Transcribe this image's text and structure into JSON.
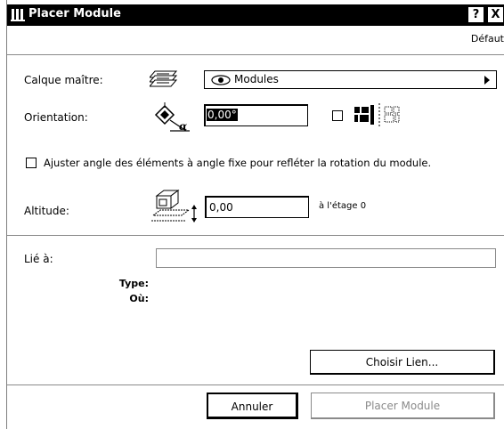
{
  "window": {
    "title": "Placer Module",
    "help_button": "?",
    "close_button": "X",
    "header_right": "Défaut"
  },
  "form": {
    "master_layer_label": "Calque maître:",
    "master_layer_value": "Modules",
    "orientation_label": "Orientation:",
    "orientation_value": "0,00°",
    "adjust_checkbox_label": "Ajuster angle des éléments à angle fixe pour refléter la rotation du module.",
    "altitude_label": "Altitude:",
    "altitude_value": "0,00",
    "altitude_reference": "à l'étage 0"
  },
  "link": {
    "label": "Lié à:",
    "value": "",
    "type_label": "Type:",
    "where_label": "Où:",
    "choose_button": "Choisir Lien..."
  },
  "footer": {
    "cancel_button": "Annuler",
    "place_button": "Placer Module"
  },
  "colors": {
    "titlebar": "#000000",
    "disabled_text": "#8a8a8a"
  }
}
